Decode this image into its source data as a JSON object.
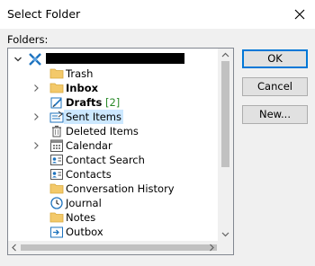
{
  "window": {
    "title": "Select Folder"
  },
  "label": "Folders:",
  "buttons": {
    "ok": "OK",
    "cancel": "Cancel",
    "new": "New..."
  },
  "tree": {
    "items": [
      {
        "label": "Trash",
        "icon": "folder-icon"
      },
      {
        "label": "Inbox",
        "icon": "folder-icon",
        "bold": true
      },
      {
        "label": "Drafts",
        "icon": "drafts-icon",
        "bold": true,
        "count": "[2]"
      },
      {
        "label": "Sent Items",
        "icon": "sent-items-icon",
        "selected": true
      },
      {
        "label": "Deleted Items",
        "icon": "trash-can-icon"
      },
      {
        "label": "Calendar",
        "icon": "calendar-icon"
      },
      {
        "label": "Contact Search",
        "icon": "contacts-icon"
      },
      {
        "label": "Contacts",
        "icon": "contacts-icon"
      },
      {
        "label": "Conversation History",
        "icon": "folder-icon"
      },
      {
        "label": "Journal",
        "icon": "journal-icon"
      },
      {
        "label": "Notes",
        "icon": "folder-icon"
      },
      {
        "label": "Outbox",
        "icon": "outbox-icon"
      }
    ]
  },
  "colors": {
    "accent": "#0078d7",
    "selection": "#cce8ff",
    "count": "#2a8a2a"
  }
}
